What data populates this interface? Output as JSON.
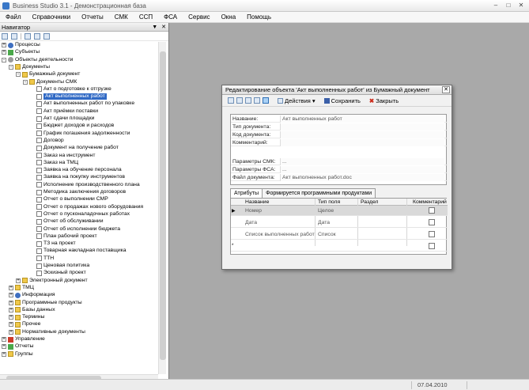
{
  "window": {
    "title": "Business Studio 3.1 - Демонстрационная база"
  },
  "menu": [
    "Файл",
    "Справочники",
    "Отчеты",
    "СМК",
    "ССП",
    "ФСА",
    "Сервис",
    "Окна",
    "Помощь"
  ],
  "navigator": {
    "title": "Навигатор",
    "tree": [
      {
        "label": "Процессы",
        "level": 0,
        "icon": "process-icon",
        "expander": "+"
      },
      {
        "label": "Субъекты",
        "level": 0,
        "icon": "subjects-icon",
        "expander": "+"
      },
      {
        "label": "Объекты деятельности",
        "level": 0,
        "icon": "objects-icon",
        "expander": "-"
      },
      {
        "label": "Документы",
        "level": 1,
        "icon": "folder-icon",
        "expander": "-"
      },
      {
        "label": "Бумажный документ",
        "level": 2,
        "icon": "folder-icon",
        "expander": "-"
      },
      {
        "label": "Документы СМК",
        "level": 3,
        "icon": "folder-icon",
        "expander": "-"
      },
      {
        "label": "Акт о подготовке к отгрузке",
        "level": 4,
        "icon": "doc-icon"
      },
      {
        "label": "Акт выполненных работ",
        "level": 4,
        "icon": "doc-icon",
        "selected": true
      },
      {
        "label": "Акт выполненных работ по упаковке",
        "level": 4,
        "icon": "doc-icon"
      },
      {
        "label": "Акт приёмки поставки",
        "level": 4,
        "icon": "doc-icon"
      },
      {
        "label": "Акт сдачи площадки",
        "level": 4,
        "icon": "doc-icon"
      },
      {
        "label": "Бюджет доходов и расходов",
        "level": 4,
        "icon": "doc-icon"
      },
      {
        "label": "График погашения задолженности",
        "level": 4,
        "icon": "doc-icon"
      },
      {
        "label": "Договор",
        "level": 4,
        "icon": "doc-icon"
      },
      {
        "label": "Документ на получение работ",
        "level": 4,
        "icon": "doc-icon"
      },
      {
        "label": "Заказ на инструмент",
        "level": 4,
        "icon": "doc-icon"
      },
      {
        "label": "Заказ на ТМЦ",
        "level": 4,
        "icon": "doc-icon"
      },
      {
        "label": "Заявка на обучение персонала",
        "level": 4,
        "icon": "doc-icon"
      },
      {
        "label": "Заявка на покупку инструментов",
        "level": 4,
        "icon": "doc-icon"
      },
      {
        "label": "Исполнение производственного плана",
        "level": 4,
        "icon": "doc-icon"
      },
      {
        "label": "Методика заключения договоров",
        "level": 4,
        "icon": "doc-icon"
      },
      {
        "label": "Отчет о выполнении СМР",
        "level": 4,
        "icon": "doc-icon"
      },
      {
        "label": "Отчет о продажах нового оборудования",
        "level": 4,
        "icon": "doc-icon"
      },
      {
        "label": "Отчет о пусконаладочных работах",
        "level": 4,
        "icon": "doc-icon"
      },
      {
        "label": "Отчет об обслуживании",
        "level": 4,
        "icon": "doc-icon"
      },
      {
        "label": "Отчет об исполнении бюджета",
        "level": 4,
        "icon": "doc-icon"
      },
      {
        "label": "План рабочий проект",
        "level": 4,
        "icon": "doc-icon"
      },
      {
        "label": "ТЗ на проект",
        "level": 4,
        "icon": "doc-icon"
      },
      {
        "label": "Товарная накладная поставщика",
        "level": 4,
        "icon": "doc-icon"
      },
      {
        "label": "ТТН",
        "level": 4,
        "icon": "doc-icon"
      },
      {
        "label": "Ценовая политика",
        "level": 4,
        "icon": "doc-icon"
      },
      {
        "label": "Эскизный проект",
        "level": 4,
        "icon": "doc-icon"
      },
      {
        "label": "Электронный документ",
        "level": 2,
        "icon": "folder-icon",
        "expander": "+"
      },
      {
        "label": "ТМЦ",
        "level": 1,
        "icon": "folder-icon",
        "expander": "+"
      },
      {
        "label": "Информация",
        "level": 1,
        "icon": "info-icon",
        "expander": "+"
      },
      {
        "label": "Программные продукты",
        "level": 1,
        "icon": "folder-icon",
        "expander": "+"
      },
      {
        "label": "Базы данных",
        "level": 1,
        "icon": "folder-icon",
        "expander": "+"
      },
      {
        "label": "Термины",
        "level": 1,
        "icon": "folder-icon",
        "expander": "+"
      },
      {
        "label": "Прочее",
        "level": 1,
        "icon": "folder-icon",
        "expander": "+"
      },
      {
        "label": "Нормативные документы",
        "level": 1,
        "icon": "folder-icon",
        "expander": "+"
      },
      {
        "label": "Управление",
        "level": 0,
        "icon": "management-icon",
        "expander": "+"
      },
      {
        "label": "Отчеты",
        "level": 0,
        "icon": "reports-icon",
        "expander": "+"
      },
      {
        "label": "Группы",
        "level": 0,
        "icon": "groups-icon",
        "expander": "+"
      }
    ]
  },
  "dialog": {
    "title": "Редактирование объекта 'Акт выполненных работ' из Бумажный документ",
    "actions_label": "Действия",
    "save_label": "Сохранить",
    "close_label": "Закрыть",
    "properties": [
      {
        "label": "Название:",
        "value": "Акт выполненных работ"
      },
      {
        "label": "Тип документа:",
        "value": ""
      },
      {
        "label": "Код документа:",
        "value": ""
      },
      {
        "label": "Комментарий:",
        "value": ""
      },
      {
        "label": "Параметры СМК:",
        "value": "..."
      },
      {
        "label": "Параметры ФСА:",
        "value": "..."
      },
      {
        "label": "Файл документа:",
        "value": "Акт выполненных работ.doc"
      }
    ],
    "tabs": [
      "Атрибуты",
      "Формируется программными продуктами"
    ],
    "grid": {
      "columns": [
        "Название",
        "Тип поля",
        "Раздел",
        "Комментарий"
      ],
      "rows": [
        {
          "name": "Номер",
          "type": "Целое",
          "section": ""
        },
        {
          "name": "Дата",
          "type": "Дата",
          "section": ""
        },
        {
          "name": "Список выполненных работ",
          "type": "Список",
          "section": ""
        }
      ]
    }
  },
  "status": {
    "date": "07.04.2010"
  }
}
